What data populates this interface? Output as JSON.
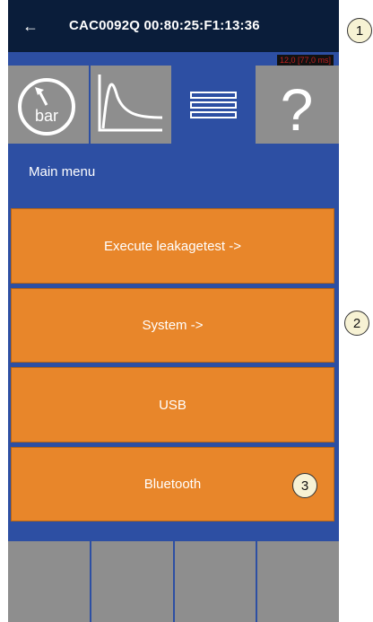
{
  "header": {
    "back_icon": "arrow-left-icon",
    "title": "CAC0092Q 00:80:25:F1:13:36",
    "timing": "12,0 [77,0 ms]"
  },
  "tabs": [
    {
      "name": "gauge",
      "label": "bar",
      "icon": "gauge-icon",
      "active": false
    },
    {
      "name": "graph",
      "icon": "graph-icon",
      "active": false
    },
    {
      "name": "menu",
      "icon": "menu-lines-icon",
      "active": true
    },
    {
      "name": "help",
      "label": "?",
      "icon": "help-icon",
      "active": false
    }
  ],
  "main": {
    "section_title": "Main menu",
    "buttons": [
      {
        "label": "Execute leakagetest ->"
      },
      {
        "label": "System ->"
      },
      {
        "label": "USB"
      },
      {
        "label": "Bluetooth"
      }
    ]
  },
  "callouts": [
    "1",
    "2",
    "3"
  ],
  "colors": {
    "background": "#2d4fa3",
    "topbar": "#0a1d3a",
    "button": "#e8862a",
    "tab_inactive": "#8e8e8e"
  }
}
